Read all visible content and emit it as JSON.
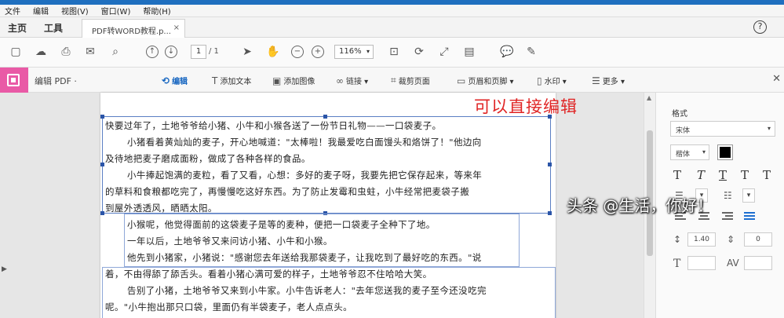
{
  "menubar": {
    "items": [
      "文件",
      "编辑",
      "视图(V)",
      "窗口(W)",
      "帮助(H)"
    ]
  },
  "tabs": {
    "home": "主页",
    "tools": "工具",
    "document": "PDF转WORD教程.p...",
    "close": "×",
    "help": "?"
  },
  "toolbar": {
    "page_current": "1",
    "page_total": "/ 1",
    "zoom": "116%",
    "icons": [
      "save-icon",
      "upload-icon",
      "print-icon",
      "mail-icon",
      "search-icon",
      "prev-page-icon",
      "next-page-icon",
      "select-cursor-icon",
      "hand-icon",
      "zoom-out-icon",
      "zoom-in-icon",
      "fit-page-icon",
      "rotate-icon",
      "fullscreen-icon",
      "scan-icon",
      "comment-icon",
      "sign-icon"
    ]
  },
  "edit_toolbar": {
    "title": "编辑 PDF ·",
    "items": [
      "编辑",
      "添加文本",
      "添加图像",
      "链接 ▾",
      "裁剪页面",
      "页眉和页脚 ▾",
      "水印 ▾",
      "更多 ▾"
    ],
    "active_index": 0
  },
  "annotation": "可以直接编辑",
  "document": {
    "lines": [
      "快要过年了，土地爷爷给小猪、小牛和小猴各送了一份节日礼物——一口袋麦子。",
      "小猪看着黄灿灿的麦子，开心地喊道：\"太棒啦！我最爱吃白面馒头和烙饼了！\"他边向",
      "及待地把麦子磨成面粉，做成了各种各样的食品。",
      "小牛捧起饱满的麦粒，看了又看，心想：多好的麦子呀，我要先把它保存起来，等来年",
      "的草料和食粮都吃完了，再慢慢吃这好东西。为了防止发霉和虫蛀，小牛经常把麦袋子搬",
      "到屋外透透风，晒晒太阳。",
      "小猴呢，他觉得面前的这袋麦子是等的麦种，便把一口袋麦子全种下了地。",
      "一年以后，土地爷爷又来问访小猪、小牛和小猴。",
      "他先到小猪家，小猪说：\"感谢您去年送给我那袋麦子，让我吃到了最好吃的东西。\"说",
      "着，不由得舔了舔舌头。看着小猪心满可爱的样子，土地爷爷忍不住哈哈大笑。",
      "告别了小猪，土地爷爷又来到小牛家。小牛告诉老人：\"去年您送我的麦子至今还没吃完",
      "呢。\"小牛抱出那只口袋，里面仍有半袋麦子，老人点点头。"
    ]
  },
  "panel": {
    "title": "格式",
    "font_name": "宋体",
    "font_size": "楷体",
    "font_color": "#000000",
    "text_styles": [
      "T",
      "T",
      "T",
      "T",
      "T"
    ],
    "line_spacing": "1.40",
    "para_spacing": "0"
  },
  "watermark": "头条 @生活，你好！"
}
